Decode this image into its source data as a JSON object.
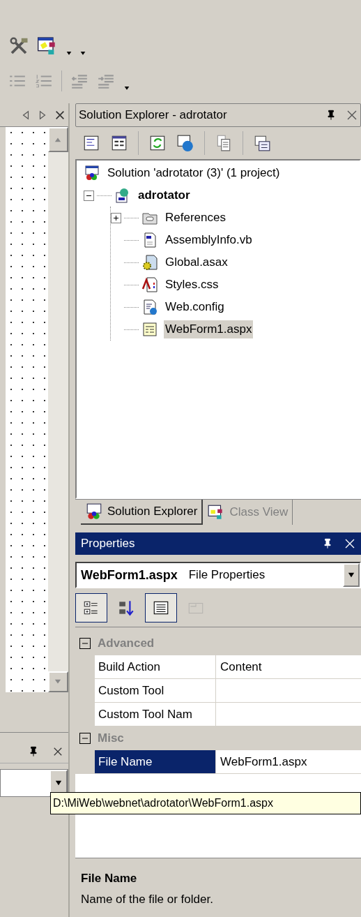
{
  "solution_explorer": {
    "title": "Solution Explorer - adrotator",
    "tree": [
      {
        "label": "Solution 'adrotator (3)' (1 project)",
        "kind": "solution",
        "selected": false,
        "children": [
          {
            "label": "adrotator",
            "kind": "project",
            "expanded": true,
            "selected": false,
            "children": [
              {
                "label": "References",
                "kind": "references",
                "expanded": false,
                "selected": false
              },
              {
                "label": "AssemblyInfo.vb",
                "kind": "vb",
                "selected": false
              },
              {
                "label": "Global.asax",
                "kind": "asax",
                "selected": false
              },
              {
                "label": "Styles.css",
                "kind": "css",
                "selected": false
              },
              {
                "label": "Web.config",
                "kind": "config",
                "selected": false
              },
              {
                "label": "WebForm1.aspx",
                "kind": "aspx",
                "selected": true
              }
            ]
          }
        ]
      }
    ]
  },
  "tabs": [
    {
      "label": "Solution Explorer",
      "selected": true
    },
    {
      "label": "Class View",
      "selected": false
    }
  ],
  "properties": {
    "title": "Properties",
    "object": {
      "name": "WebForm1.aspx",
      "type": "File Properties"
    },
    "view_buttons": [
      {
        "kind": "categorized",
        "pressed": true,
        "disabled": false
      },
      {
        "kind": "alphabetical",
        "pressed": false,
        "disabled": false
      },
      {
        "kind": "properties",
        "pressed": true,
        "disabled": false
      },
      {
        "kind": "property_pages",
        "pressed": false,
        "disabled": true
      }
    ],
    "categories": [
      {
        "name": "Advanced",
        "expanded": true,
        "rows": [
          {
            "name": "Build Action",
            "value": "Content",
            "selected": false
          },
          {
            "name": "Custom Tool",
            "selected": false
          },
          {
            "name": "Custom Tool Nam",
            "selected": false
          }
        ]
      },
      {
        "name": "Misc",
        "expanded": true,
        "rows": [
          {
            "name": "File Name",
            "value": "WebForm1.aspx",
            "selected": true
          }
        ]
      }
    ],
    "tooltip": "D:\\MiWeb\\webnet\\adrotator\\WebForm1.aspx",
    "description": {
      "title": "File Name",
      "text": "Name of the file or folder."
    }
  }
}
